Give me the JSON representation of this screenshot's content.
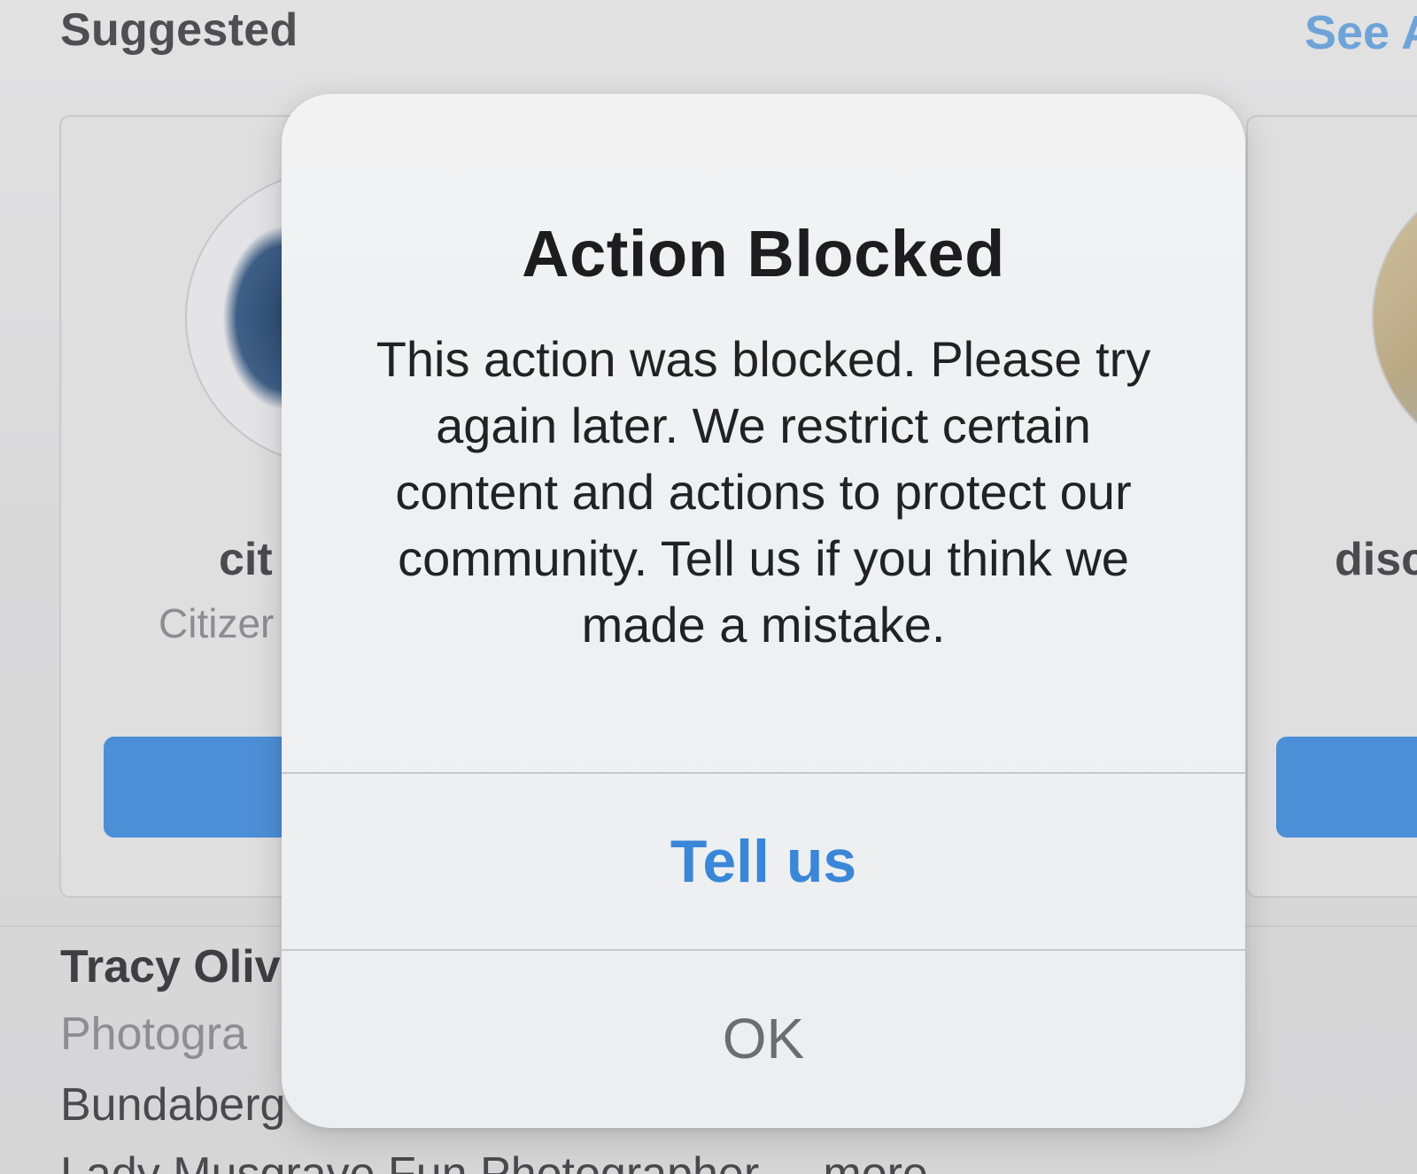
{
  "background": {
    "section_title": "Suggested",
    "see_all_label": "See A",
    "cards": [
      {
        "username": "cit",
        "subname": "Citizer"
      },
      {
        "username": "disc"
      }
    ],
    "profile": {
      "name": "Tracy Oliv",
      "category": "Photogra",
      "location": "Bundaberg",
      "bio": "Lady Musgrave Fun Photographer ... more"
    }
  },
  "dialog": {
    "title": "Action Blocked",
    "message": "This action was blocked. Please try again later. We restrict certain content and actions to protect our community. Tell us if you think we made a mistake.",
    "primary_button": "Tell us",
    "secondary_button": "OK"
  },
  "colors": {
    "accent_blue": "#3a86d8",
    "follow_button": "#4d8fd6",
    "dialog_bg": "#f0f1f3",
    "backdrop": "#dadadb"
  }
}
